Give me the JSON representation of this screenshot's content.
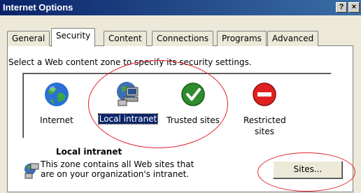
{
  "window": {
    "title": "Internet Options",
    "help_label": "?",
    "close_label": "×"
  },
  "tabs": [
    {
      "label": "General"
    },
    {
      "label": "Security"
    },
    {
      "label": "Content"
    },
    {
      "label": "Connections"
    },
    {
      "label": "Programs"
    },
    {
      "label": "Advanced"
    }
  ],
  "security": {
    "instruction": "Select a Web content zone to specify its security settings.",
    "zones": [
      {
        "label": "Internet",
        "icon": "globe-icon"
      },
      {
        "label": "Local intranet",
        "icon": "network-icon"
      },
      {
        "label": "Trusted sites",
        "icon": "checkmark-icon"
      },
      {
        "label": "Restricted sites",
        "icon": "no-entry-icon"
      }
    ],
    "selected_zone_title": "Local intranet",
    "zone_description_line1": "This zone contains all Web sites that",
    "zone_description_line2": "are on your organization's intranet.",
    "sites_button": "Sites..."
  },
  "colors": {
    "annotation": "#e0202a",
    "selection": "#0a246a",
    "titlebar": "#0a246a"
  }
}
